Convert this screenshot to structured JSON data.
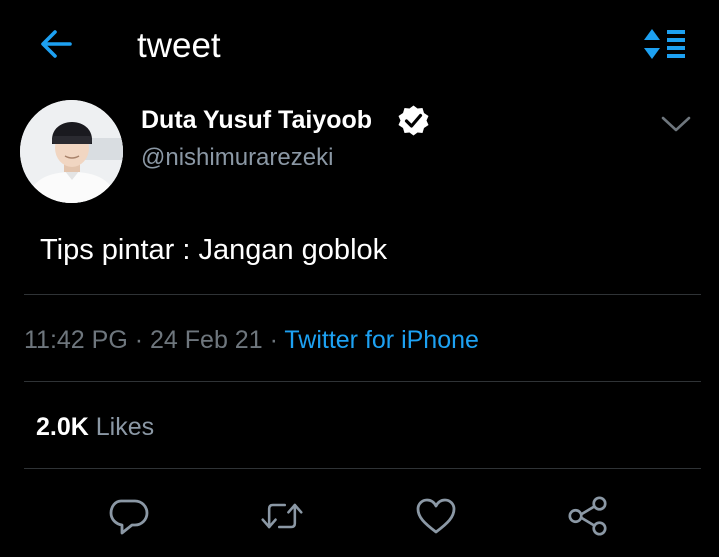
{
  "header": {
    "title": "tweet",
    "back_icon": "arrow-left-icon",
    "sort_icon": "sort-list-icon",
    "accent_color": "#1da1f2"
  },
  "tweet": {
    "author": {
      "display_name": "Duta Yusuf Taiyoob",
      "handle": "@nishimurarezeki",
      "verified": true
    },
    "text": "Tips pintar : Jangan goblok",
    "time": "11:42 PG",
    "separator": "·",
    "date": "24 Feb 21",
    "source": "Twitter for iPhone",
    "likes_count": "2.0K",
    "likes_label": "Likes"
  },
  "actions": [
    {
      "icon": "reply-icon"
    },
    {
      "icon": "retweet-icon"
    },
    {
      "icon": "like-icon"
    },
    {
      "icon": "share-icon"
    }
  ],
  "colors": {
    "background": "#000000",
    "text_primary": "#ffffff",
    "text_secondary": "#8b98a5",
    "divider": "#2f3336",
    "link": "#1da1f2"
  }
}
